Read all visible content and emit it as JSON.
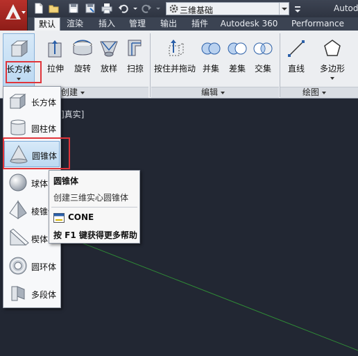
{
  "titlebar": {
    "workspace": "三维基础",
    "app_name": "Autod"
  },
  "tabs": [
    "默认",
    "渲染",
    "插入",
    "管理",
    "输出",
    "插件",
    "Autodesk 360",
    "Performance"
  ],
  "ribbon": {
    "create_panel": {
      "title": "创建",
      "box": "长方体",
      "extrude": "拉伸",
      "revolve": "旋转",
      "loft": "放样",
      "sweep": "扫掠"
    },
    "edit_panel": {
      "title": "编辑",
      "presspull": "按住并拖动",
      "union": "并集",
      "subtract": "差集",
      "intersect": "交集"
    },
    "draw_panel": {
      "title": "绘图",
      "line": "直线",
      "polygon": "多边形"
    }
  },
  "viewport": {
    "label": "]真实]"
  },
  "dropdown": {
    "items": [
      "长方体",
      "圆柱体",
      "圆锥体",
      "球体",
      "棱锥体",
      "楔体",
      "圆环体",
      "多段体"
    ]
  },
  "tooltip": {
    "title": "圆锥体",
    "description": "创建三维实心圆锥体",
    "command": "CONE",
    "help": "按 F1 键获得更多帮助"
  },
  "colors": {
    "highlight_border": "#e0343a",
    "viewport_bg": "#222733",
    "ribbon_bg": "#eceef1",
    "titlebar_bg": "#2e3441"
  }
}
